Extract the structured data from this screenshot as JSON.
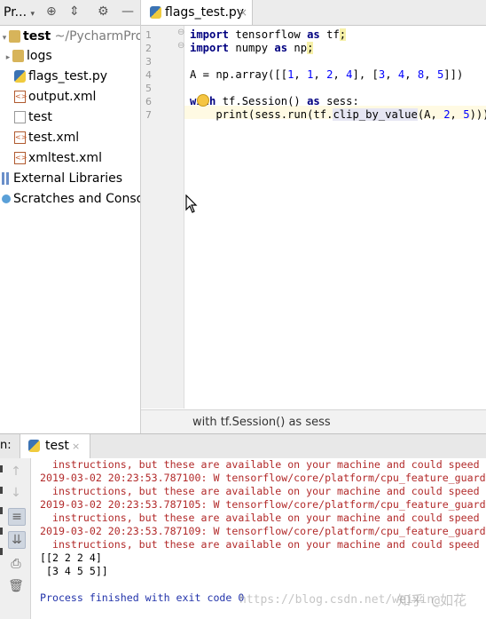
{
  "project_panel": {
    "title": "Pr...",
    "toolbar_icons": [
      "target-icon",
      "collapse-icon",
      "gear-icon",
      "minimize-icon"
    ],
    "root_name": "test",
    "root_path": "~/PycharmProjec",
    "items": [
      {
        "label": "logs",
        "icon": "folder-icon"
      },
      {
        "label": "flags_test.py",
        "icon": "python-file-icon"
      },
      {
        "label": "output.xml",
        "icon": "xml-file-icon"
      },
      {
        "label": "test",
        "icon": "file-icon"
      },
      {
        "label": "test.xml",
        "icon": "xml-file-icon"
      },
      {
        "label": "xmltest.xml",
        "icon": "xml-file-icon"
      }
    ],
    "external_libraries": "External Libraries",
    "scratches": "Scratches and Consoles"
  },
  "editor": {
    "tab_label": "flags_test.py",
    "tab_close": "×",
    "line_numbers": [
      "1",
      "2",
      "3",
      "4",
      "5",
      "6",
      "7"
    ],
    "lines": [
      "import tensorflow as tf;",
      "import numpy as np;",
      "",
      "A = np.array([[1, 1, 2, 4], [3, 4, 8, 5]])",
      "",
      "with tf.Session() as sess:",
      "    print(sess.run(tf.clip_by_value(A, 2, 5)))"
    ],
    "breadcrumb": "with tf.Session() as sess"
  },
  "run_panel": {
    "label": "n:",
    "tab_label": "test",
    "tab_close": "×",
    "console_lines": [
      {
        "text": "  instructions, but these are available on your machine and could speed u",
        "style": "red"
      },
      {
        "text": "2019-03-02 20:23:53.787100: W tensorflow/core/platform/cpu_feature_guard",
        "style": "red"
      },
      {
        "text": "  instructions, but these are available on your machine and could speed u",
        "style": "red"
      },
      {
        "text": "2019-03-02 20:23:53.787105: W tensorflow/core/platform/cpu_feature_guard",
        "style": "red"
      },
      {
        "text": "  instructions, but these are available on your machine and could speed u",
        "style": "red"
      },
      {
        "text": "2019-03-02 20:23:53.787109: W tensorflow/core/platform/cpu_feature_guard",
        "style": "red"
      },
      {
        "text": "  instructions, but these are available on your machine and could speed u",
        "style": "red"
      },
      {
        "text": "[[2 2 2 4]",
        "style": "blk"
      },
      {
        "text": " [3 4 5 5]]",
        "style": "blk"
      },
      {
        "text": "",
        "style": "blk"
      },
      {
        "text": "Process finished with exit code 0",
        "style": "blue"
      }
    ],
    "watermark_url": "https://blog.csdn.net/weixin_",
    "watermark_brand": "知乎 @如花"
  }
}
